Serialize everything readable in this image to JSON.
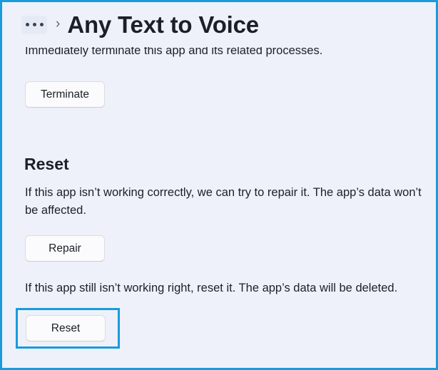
{
  "window": {
    "accent_color": "#199bdc",
    "background_color": "#eef1fa",
    "button_fill": "#fbfbfd"
  },
  "header": {
    "breadcrumb_overflow": "overflow-ellipsis",
    "breadcrumb_separator": "›",
    "title": "Any Text to Voice"
  },
  "main": {
    "terminate_section": {
      "description": "Immediately terminate this app and its related processes.",
      "button_label": "Terminate"
    },
    "reset_section": {
      "heading": "Reset",
      "repair_description": "If this app isn’t working correctly, we can try to repair it. The app’s data won’t be affected.",
      "repair_button_label": "Repair",
      "reset_description": "If this app still isn’t working right, reset it. The app’s data will be deleted.",
      "reset_button_label": "Reset"
    }
  }
}
